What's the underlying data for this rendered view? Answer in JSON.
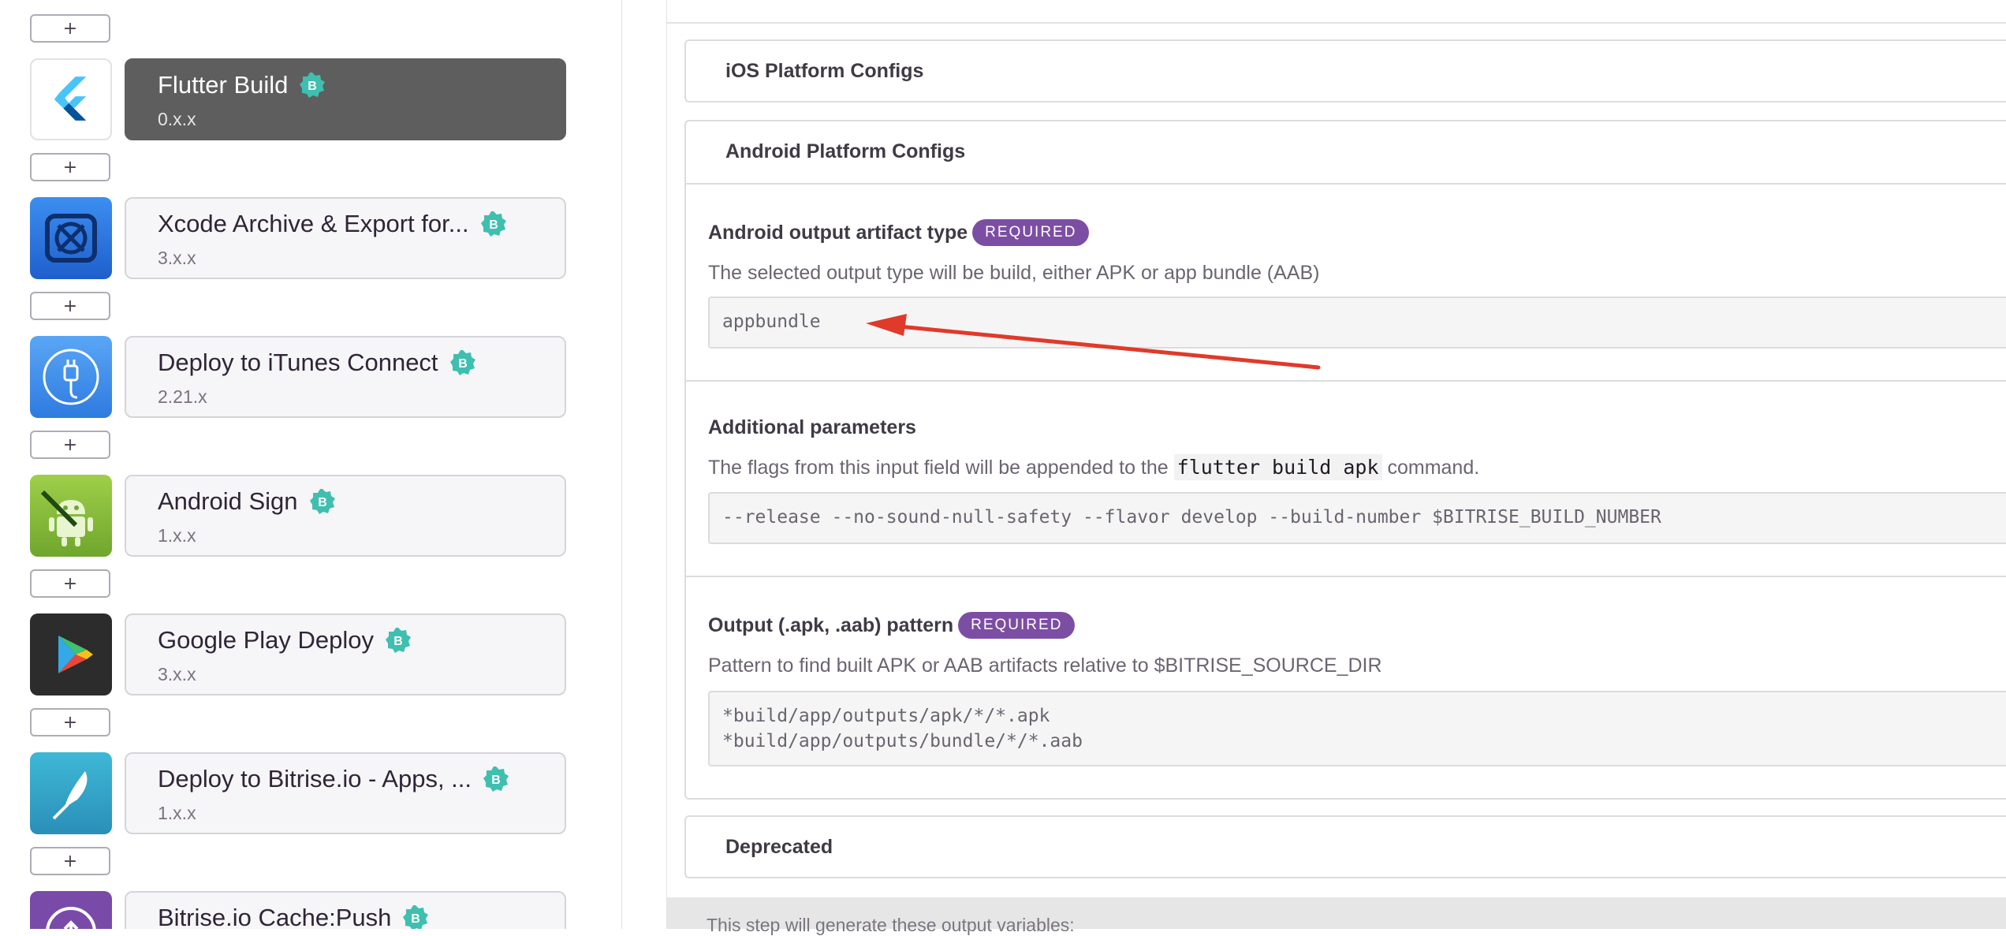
{
  "steps": [
    {
      "title": "Flutter Build",
      "version": "0.x.x",
      "icon": "flutter-icon",
      "active": true
    },
    {
      "title": "Xcode Archive & Export for...",
      "version": "3.x.x",
      "icon": "xcode-icon",
      "active": false
    },
    {
      "title": "Deploy to iTunes Connect",
      "version": "2.21.x",
      "icon": "itunes-connect-icon",
      "active": false
    },
    {
      "title": "Android Sign",
      "version": "1.x.x",
      "icon": "android-icon",
      "active": false
    },
    {
      "title": "Google Play Deploy",
      "version": "3.x.x",
      "icon": "google-play-icon",
      "active": false
    },
    {
      "title": "Deploy to Bitrise.io - Apps, ...",
      "version": "1.x.x",
      "icon": "bitrise-deploy-icon",
      "active": false
    },
    {
      "title": "Bitrise.io Cache:Push",
      "version": "",
      "icon": "bitrise-cache-icon",
      "active": false
    }
  ],
  "add_button_label": "+",
  "sections": {
    "ios": "iOS Platform Configs",
    "android": "Android Platform Configs",
    "deprecated": "Deprecated"
  },
  "inputs": {
    "artifact_type": {
      "label": "Android output artifact type",
      "required": "REQUIRED",
      "description": "The selected output type will be build, either APK or app bundle (AAB)",
      "value": "appbundle"
    },
    "additional_params": {
      "label": "Additional parameters",
      "description_before": "The flags from this input field will be appended to the",
      "description_code": "flutter build apk",
      "description_after": "command.",
      "value": "--release --no-sound-null-safety --flavor develop --build-number $BITRISE_BUILD_NUMBER"
    },
    "output_pattern": {
      "label": "Output (.apk, .aab) pattern",
      "required": "REQUIRED",
      "description": "Pattern to find built APK or AAB artifacts relative to $BITRISE_SOURCE_DIR",
      "value_line1": "*build/app/outputs/apk/*/*.apk",
      "value_line2": "*build/app/outputs/bundle/*/*.aab"
    }
  },
  "output_variables_text": "This step will generate these output variables:",
  "colors": {
    "accent_purple": "#7c4ea3",
    "badge_teal": "#3fbfb0",
    "arrow_red": "#e03a2a",
    "active_card": "#5e5e5e"
  }
}
